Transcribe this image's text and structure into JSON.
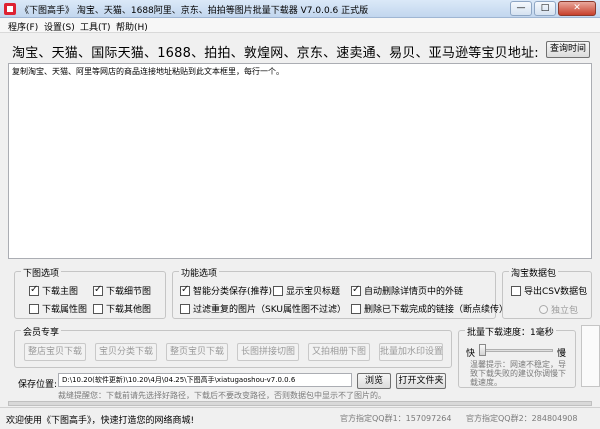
{
  "window": {
    "title": "《下图高手》 淘宝、天猫、1688阿里、京东、拍拍等图片批量下载器 V7.0.0.6 正式版",
    "minimize_glyph": "—",
    "maximize_glyph": "□",
    "close_glyph": "✕"
  },
  "menu": [
    "程序(F)",
    "设置(S)",
    "工具(T)",
    "帮助(H)"
  ],
  "header": {
    "platforms_label": "淘宝、天猫、国际天猫、1688、拍拍、敦煌网、京东、速卖通、易贝、亚马逊等宝贝地址:",
    "query_time_button": "查询时间"
  },
  "url_input": {
    "text": "复制淘宝、天猫、阿里等网店的商品连接地址粘贴到此文本框里，每行一个。"
  },
  "download_options": {
    "legend": "下图选项",
    "items": [
      {
        "label": "下载主图",
        "checked": true
      },
      {
        "label": "下载细节图",
        "checked": true
      },
      {
        "label": "下载属性图",
        "checked": false
      },
      {
        "label": "下载其他图",
        "checked": false
      }
    ]
  },
  "function_options": {
    "legend": "功能选项",
    "items": [
      {
        "label": "智能分类保存(推荐)",
        "checked": true
      },
      {
        "label": "显示宝贝标题",
        "checked": false
      },
      {
        "label": "自动删除详情页中的外链",
        "checked": true
      },
      {
        "label": "过滤重复的图片（SKU属性图不过滤）",
        "checked": false
      },
      {
        "label": "删除已下载完成的链接（断点续传）",
        "checked": false
      }
    ]
  },
  "taobao_package": {
    "legend": "淘宝数据包",
    "export_csv": "导出CSV数据包",
    "standalone": "独立包"
  },
  "member": {
    "legend": "会员专享",
    "buttons": [
      "整店宝贝下载",
      "宝贝分类下载",
      "整页宝贝下载",
      "长图拼接切图",
      "又拍相册下图",
      "批量加水印设置"
    ]
  },
  "speed": {
    "legend": "批量下载速度：1毫秒",
    "fast": "快",
    "slow": "慢",
    "value_ms": 1,
    "tip": "温馨提示：网速不稳定，导致下载失败的建议你调慢下载速度。"
  },
  "save": {
    "label": "保存位置:",
    "path": "D:\\10.20(软件更新)\\10.20\\4月\\04.25\\下图高手\\xiatugaoshou-v7.0.0.6",
    "browse_button": "浏览",
    "open_folder_button": "打开文件夹",
    "hint": "裁缝提醒您：下载前请先选择好路径，下载后不要改变路径，否则数据包中显示不了图片的。"
  },
  "status": {
    "welcome": "欢迎使用《下图高手》，快速打造您的网络商城!",
    "qq_group1": "官方指定QQ群1：157097264",
    "qq_group2": "官方指定QQ群2：284804908"
  }
}
